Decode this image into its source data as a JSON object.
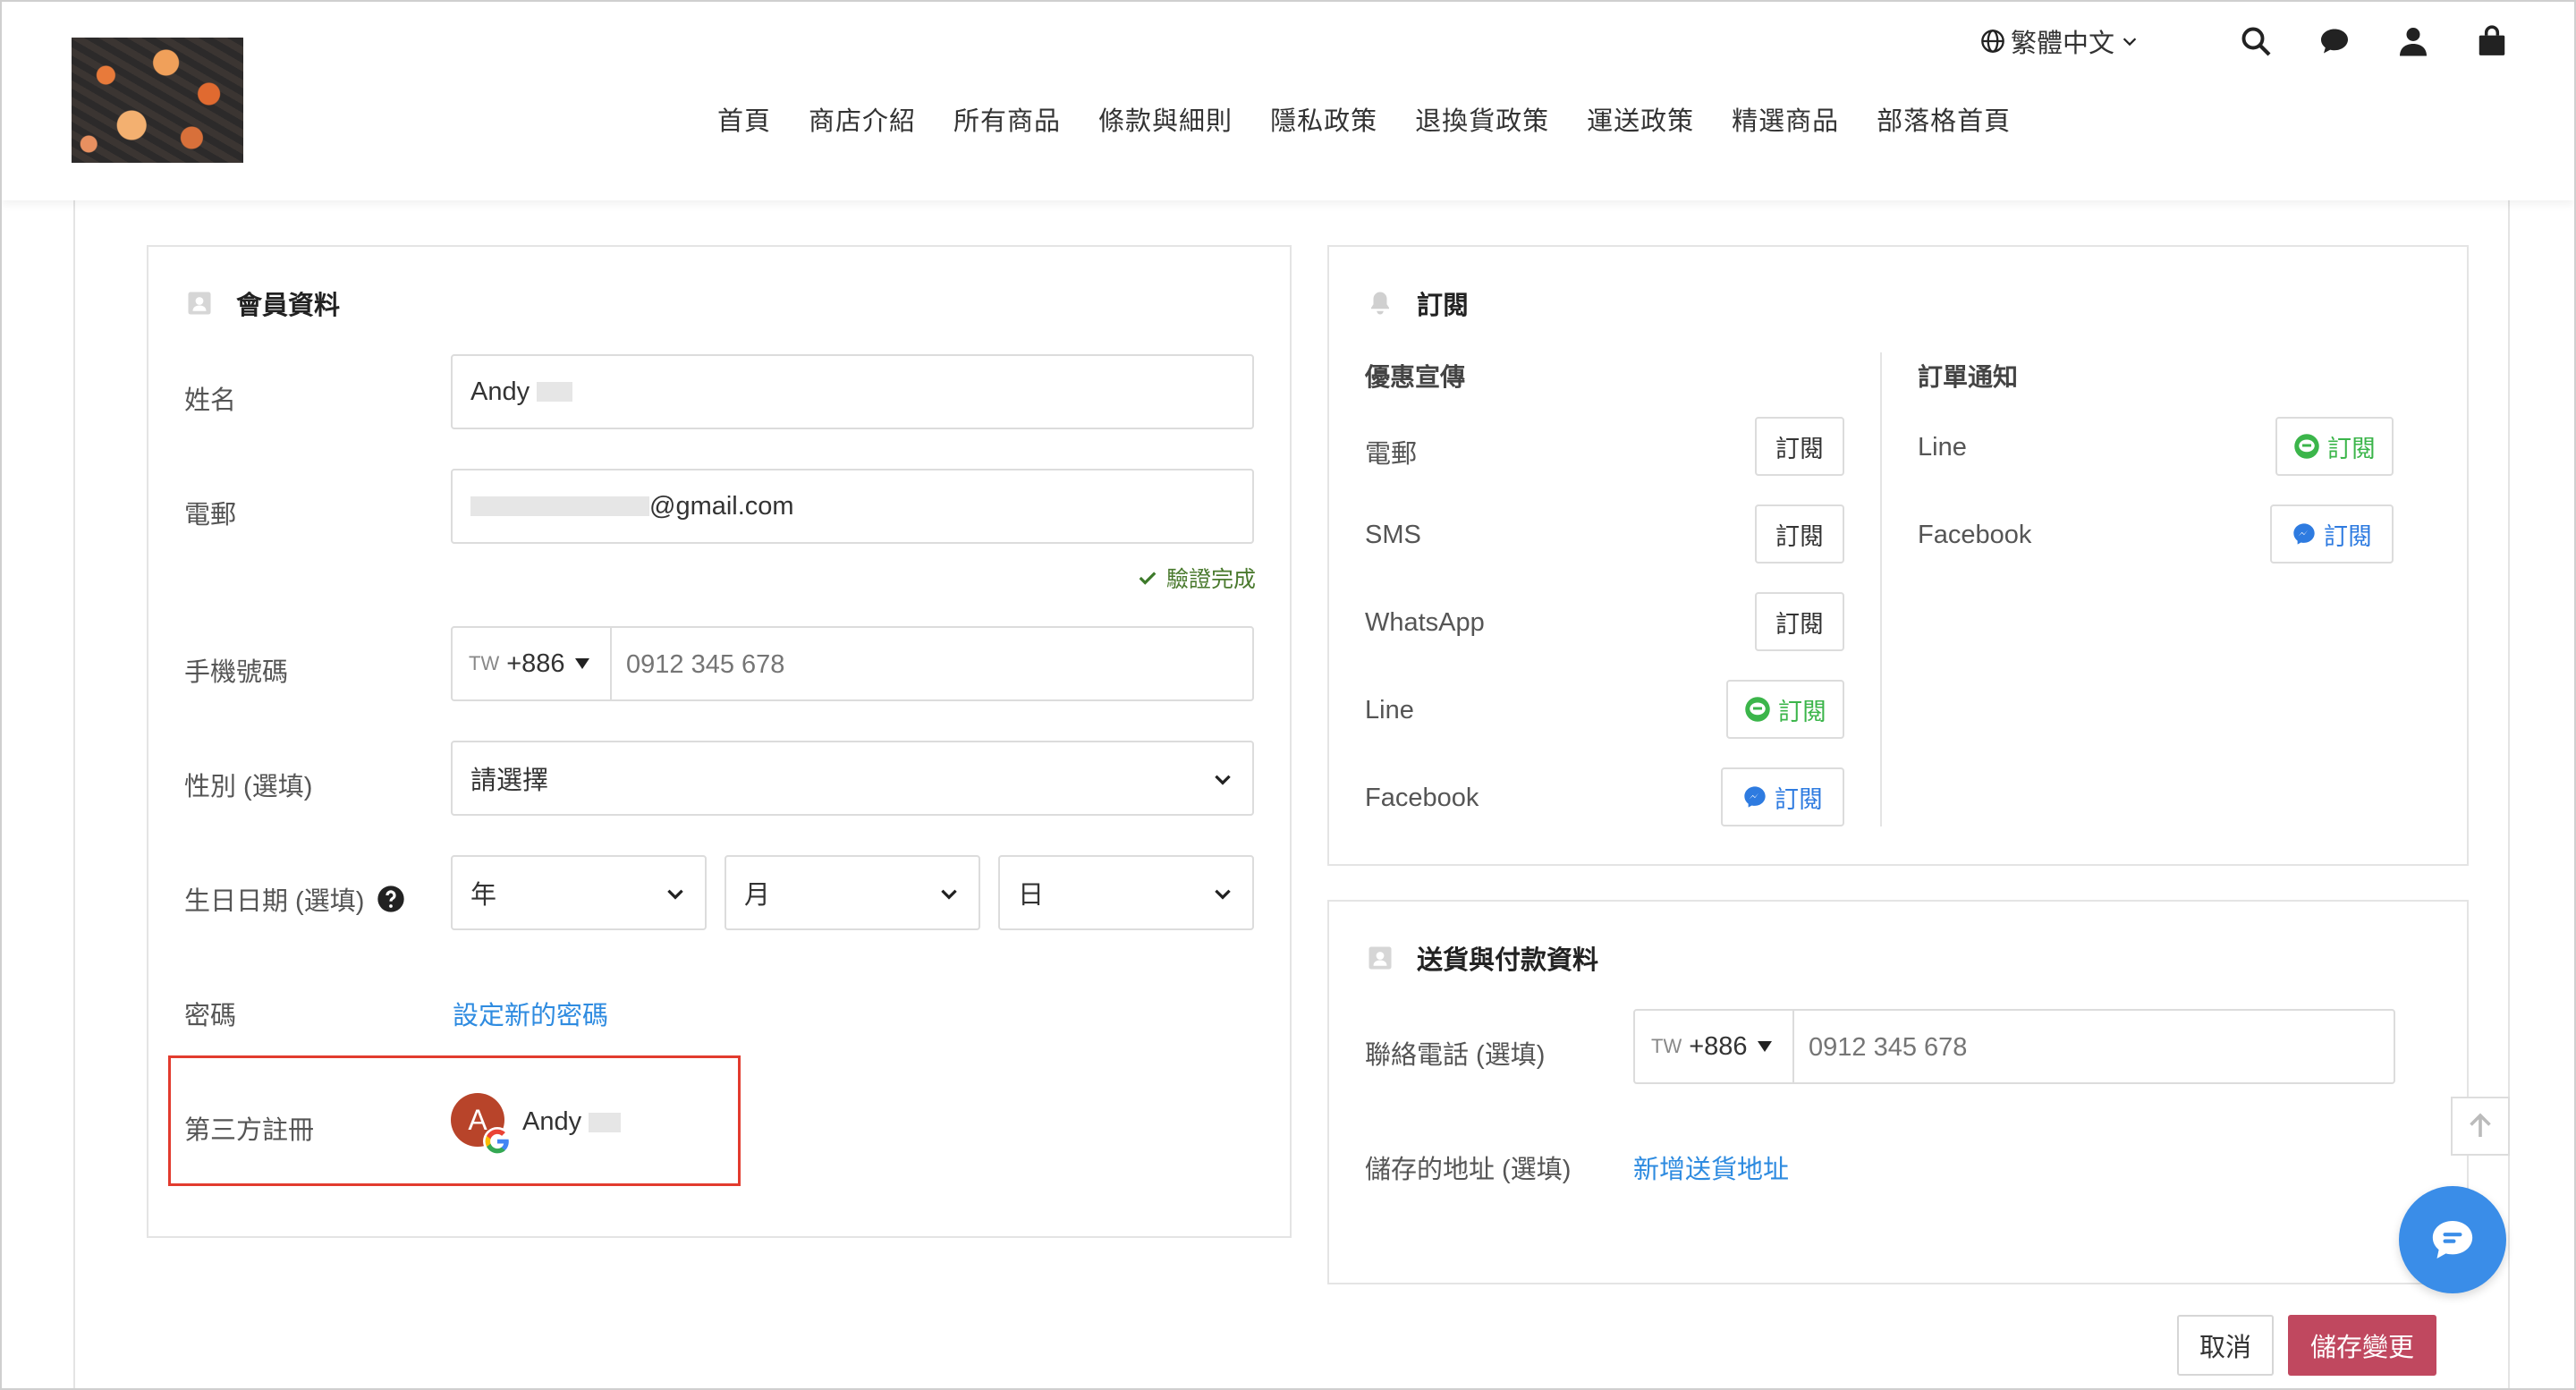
{
  "header": {
    "nav": [
      "首頁",
      "商店介紹",
      "所有商品",
      "條款與細則",
      "隱私政策",
      "退換貨政策",
      "運送政策",
      "精選商品",
      "部落格首頁"
    ],
    "language": "繁體中文",
    "icons": [
      "globe-icon",
      "search-icon",
      "chat-bubble-icon",
      "user-icon",
      "shopping-bag-icon"
    ]
  },
  "member": {
    "title": "會員資料",
    "name_label": "姓名",
    "name_value": "Andy",
    "email_label": "電郵",
    "email_value": "@gmail.com",
    "email_verified": "驗證完成",
    "phone_label": "手機號碼",
    "phone_country": "TW",
    "phone_code": "+886",
    "phone_placeholder": "0912 345 678",
    "gender_label": "性別 (選填)",
    "gender_value": "請選擇",
    "birthday_label": "生日日期 (選填)",
    "birthday_year": "年",
    "birthday_month": "月",
    "birthday_day": "日",
    "password_label": "密碼",
    "password_link": "設定新的密碼",
    "third_party_label": "第三方註冊",
    "third_party_avatar": "A",
    "third_party_name": "Andy"
  },
  "subscription": {
    "title": "訂閱",
    "promo_title": "優惠宣傳",
    "order_title": "訂單通知",
    "subscribe_label": "訂閱",
    "promo_channels": [
      "電郵",
      "SMS",
      "WhatsApp",
      "Line",
      "Facebook"
    ],
    "order_channels": [
      "Line",
      "Facebook"
    ]
  },
  "delivery": {
    "title": "送貨與付款資料",
    "phone_label": "聯絡電話 (選填)",
    "phone_country": "TW",
    "phone_code": "+886",
    "phone_placeholder": "0912 345 678",
    "address_label": "儲存的地址 (選填)",
    "address_link": "新增送貨地址"
  },
  "actions": {
    "cancel": "取消",
    "save": "儲存變更"
  },
  "colors": {
    "link": "#2e8be0",
    "save_button": "#c0485f",
    "line_green": "#3bb54a",
    "messenger_blue": "#2e7be0",
    "highlight_red": "#e23b2e",
    "chat_fab": "#3a8de8"
  }
}
